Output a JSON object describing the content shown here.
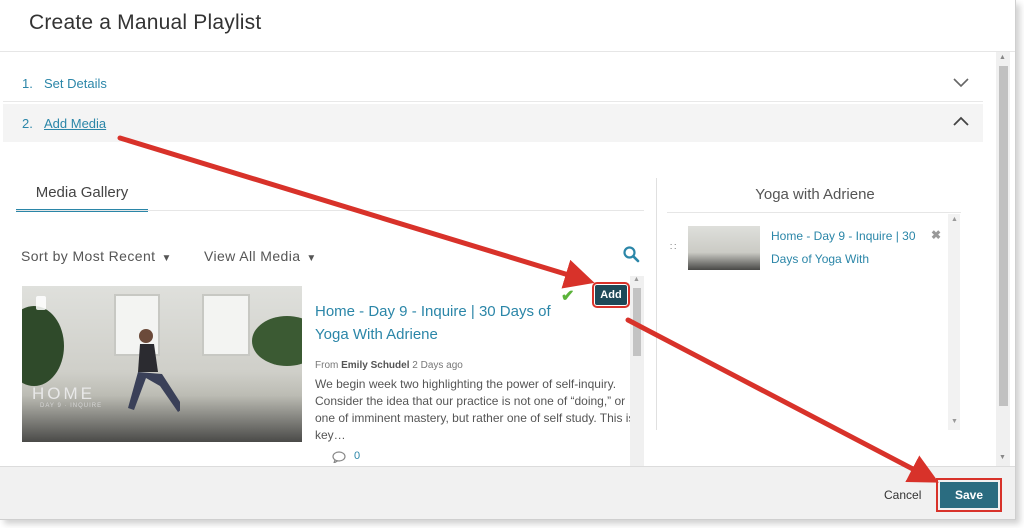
{
  "dialog": {
    "title": "Create a Manual Playlist"
  },
  "steps": [
    {
      "num": "1.",
      "label": "Set Details"
    },
    {
      "num": "2.",
      "label": "Add Media"
    }
  ],
  "gallery": {
    "tab_label": "Media Gallery",
    "sort_label": "Sort by Most Recent",
    "view_label": "View All Media",
    "item": {
      "thumb_text": "HOME",
      "thumb_subtext": "DAY 9 · INQUIRE",
      "title": "Home - Day 9 - Inquire | 30 Days of Yoga With Adriene",
      "meta_from": "From",
      "meta_author": "Emily Schudel",
      "meta_time": "2 Days ago",
      "description": "We begin week two highlighting the power of self-inquiry. Consider the idea that our practice is not one of “doing,” or one of imminent mastery, but rather one of self study. This is key…",
      "comments": "0",
      "add_label": "Add",
      "added_check": "✔"
    }
  },
  "playlist": {
    "title": "Yoga with Adriene",
    "item_title": "Home - Day 9 - Inquire | 30 Days of Yoga With",
    "remove_glyph": "✖",
    "drag_glyph": "∷"
  },
  "footer": {
    "cancel_label": "Cancel",
    "save_label": "Save"
  },
  "colors": {
    "accent": "#2b86a8",
    "save": "#2a6c80",
    "add": "#1e4958",
    "annotation": "#d8322a"
  }
}
